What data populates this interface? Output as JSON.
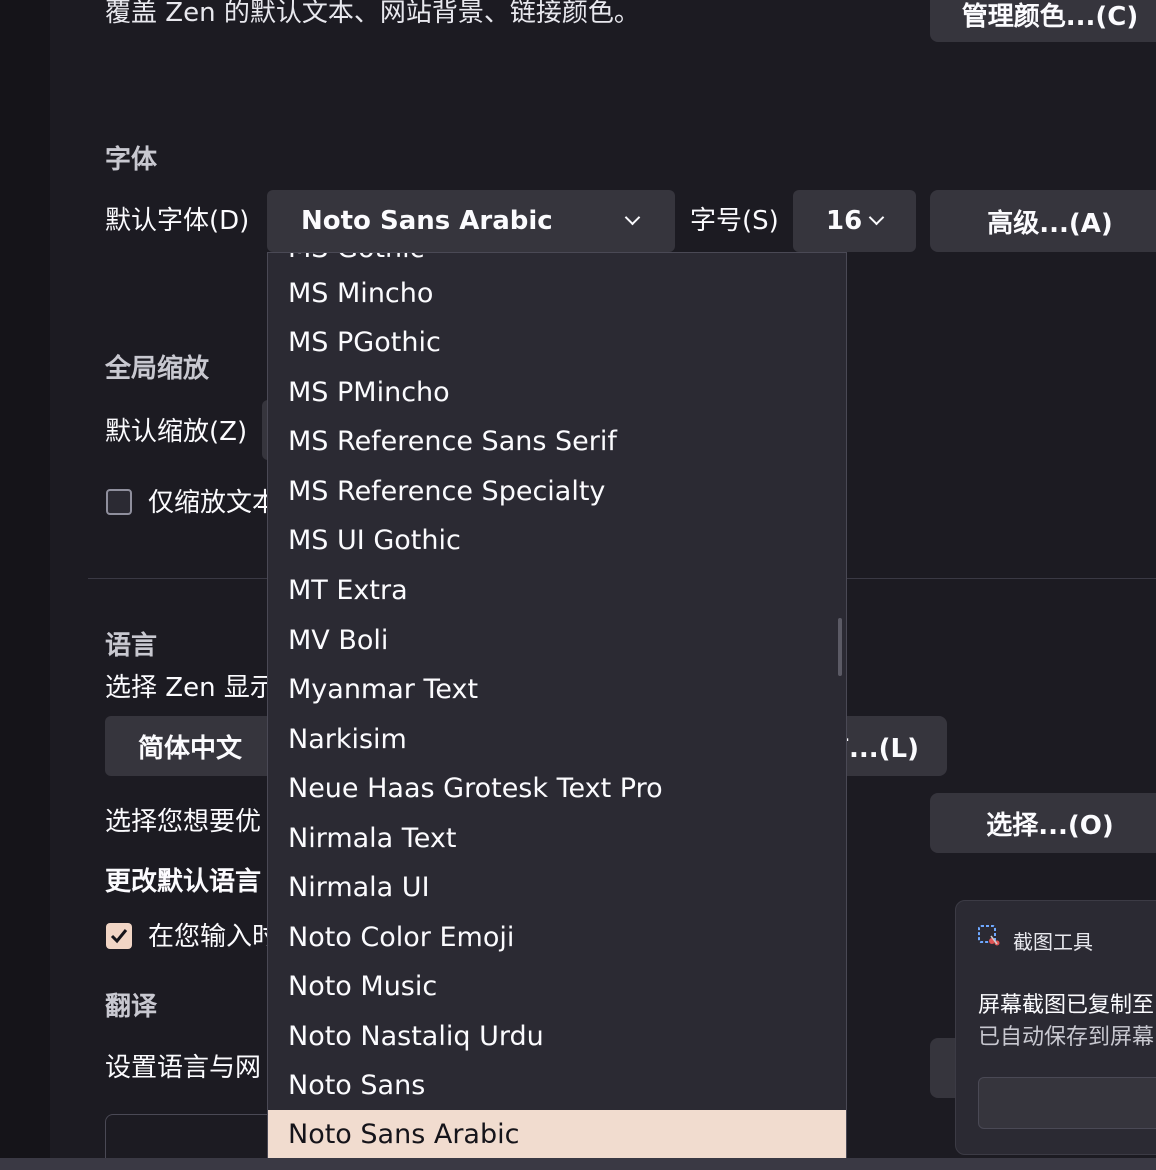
{
  "colors_intro": "覆盖 Zen 的默认文本、网站背景、链接颜色。",
  "manage_colors_button": "管理颜色...(C)",
  "fonts": {
    "heading": "字体",
    "default_font_label": "默认字体(D)",
    "default_font_value": "Noto Sans Arabic",
    "size_label": "字号(S)",
    "size_value": "16",
    "advanced_button": "高级...(A)"
  },
  "zoom": {
    "heading": "全局缩放",
    "default_zoom_label": "默认缩放(Z)",
    "text_only_label": "仅缩放文本",
    "text_only_checked": false
  },
  "language": {
    "heading": "语言",
    "intro": "选择 Zen 显示",
    "current_language": "简体中文",
    "alternatives_button": "言...(L)",
    "preferred_label": "选择您想要优",
    "choose_button": "选择...(O)",
    "change_default_heading": "更改默认语言",
    "spellcheck_label": "在您输入时",
    "spellcheck_checked": true
  },
  "translation": {
    "heading": "翻译",
    "intro": "设置语言与网"
  },
  "font_dropdown": {
    "options": [
      "MS Gothic",
      "MS Mincho",
      "MS PGothic",
      "MS PMincho",
      "MS Reference Sans Serif",
      "MS Reference Specialty",
      "MS UI Gothic",
      "MT Extra",
      "MV Boli",
      "Myanmar Text",
      "Narkisim",
      "Neue Haas Grotesk Text Pro",
      "Nirmala Text",
      "Nirmala UI",
      "Noto Color Emoji",
      "Noto Music",
      "Noto Nastaliq Urdu",
      "Noto Sans",
      "Noto Sans Arabic"
    ],
    "selected_index": 18
  },
  "toast": {
    "app_name": "截图工具",
    "line1": "屏幕截图已复制至",
    "line2": "已自动保存到屏幕"
  },
  "colors": {
    "background": "#1c1b22",
    "button": "#36353d",
    "dropdown": "#2b2a33",
    "selected_option": "#f1dccf",
    "accent": "#f1d5c5"
  }
}
